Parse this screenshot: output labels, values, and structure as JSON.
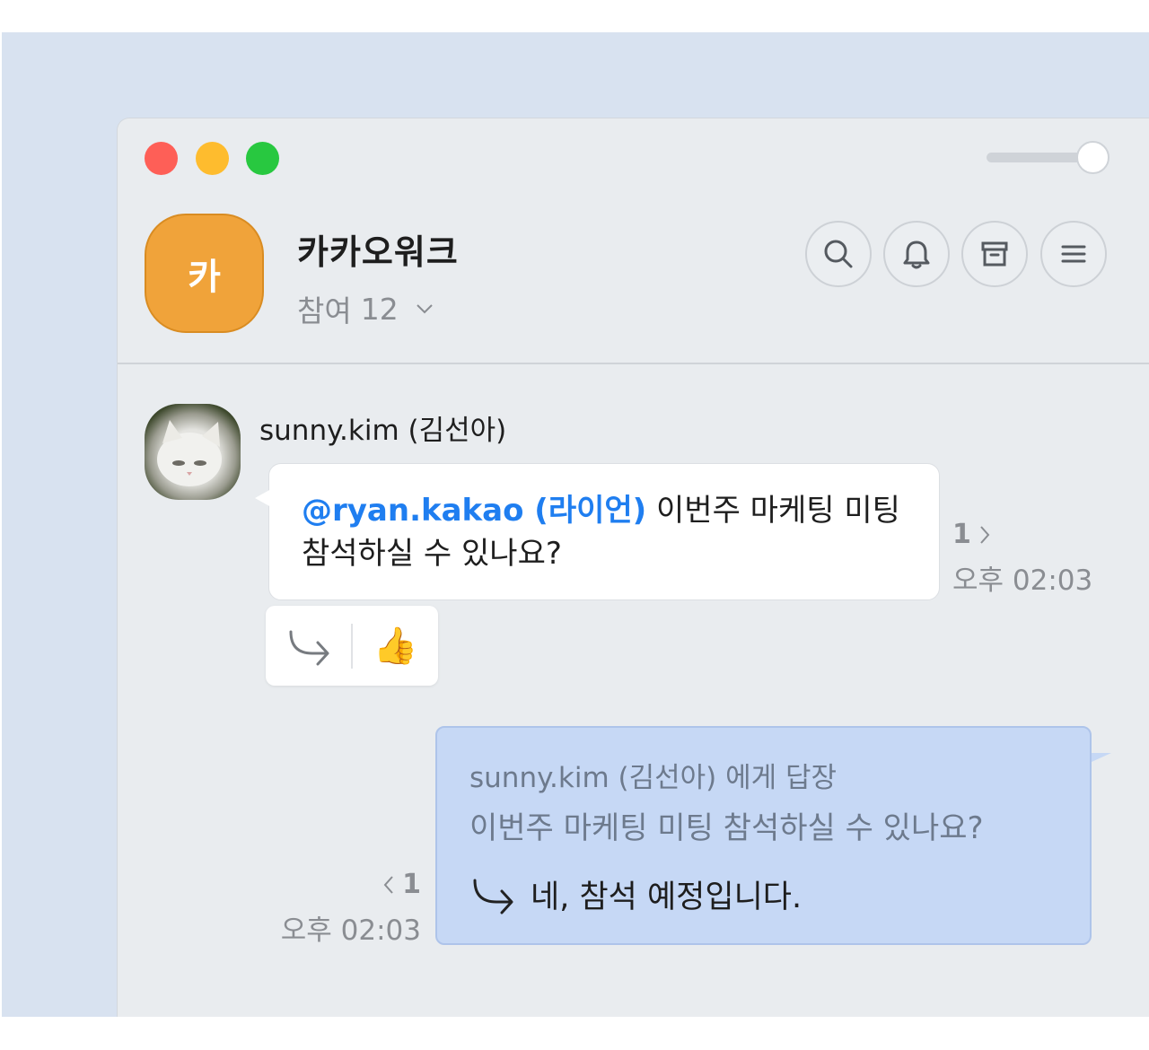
{
  "header": {
    "room_avatar_text": "카",
    "room_title": "카카오워크",
    "participants_label": "참여",
    "participants_count": "12"
  },
  "messages": {
    "incoming": {
      "sender": "sunny.kim (김선아)",
      "mention": "@ryan.kakao (라이언)",
      "text": " 이번주 마케팅 미팅 참석하실 수 있나요?",
      "unread_count": "1",
      "time": "오후 02:03",
      "reaction_emoji": "👍"
    },
    "outgoing": {
      "reply_to_label": "sunny.kim (김선아) 에게 답장",
      "quoted_text": "이번주 마케팅 미팅 참석하실 수 있나요?",
      "answer_text": "네, 참석 예정입니다.",
      "unread_count": "1",
      "time": "오후 02:03"
    }
  },
  "icons": {
    "search": "search-icon",
    "bell": "bell-icon",
    "archive": "archive-icon",
    "menu": "menu-icon"
  },
  "colors": {
    "room_avatar": "#f0a33a",
    "mention": "#1f7ef0",
    "outgoing_bubble": "#c6d8f5",
    "window_bg": "#e9ecef",
    "backdrop": "#d8e2f0"
  }
}
